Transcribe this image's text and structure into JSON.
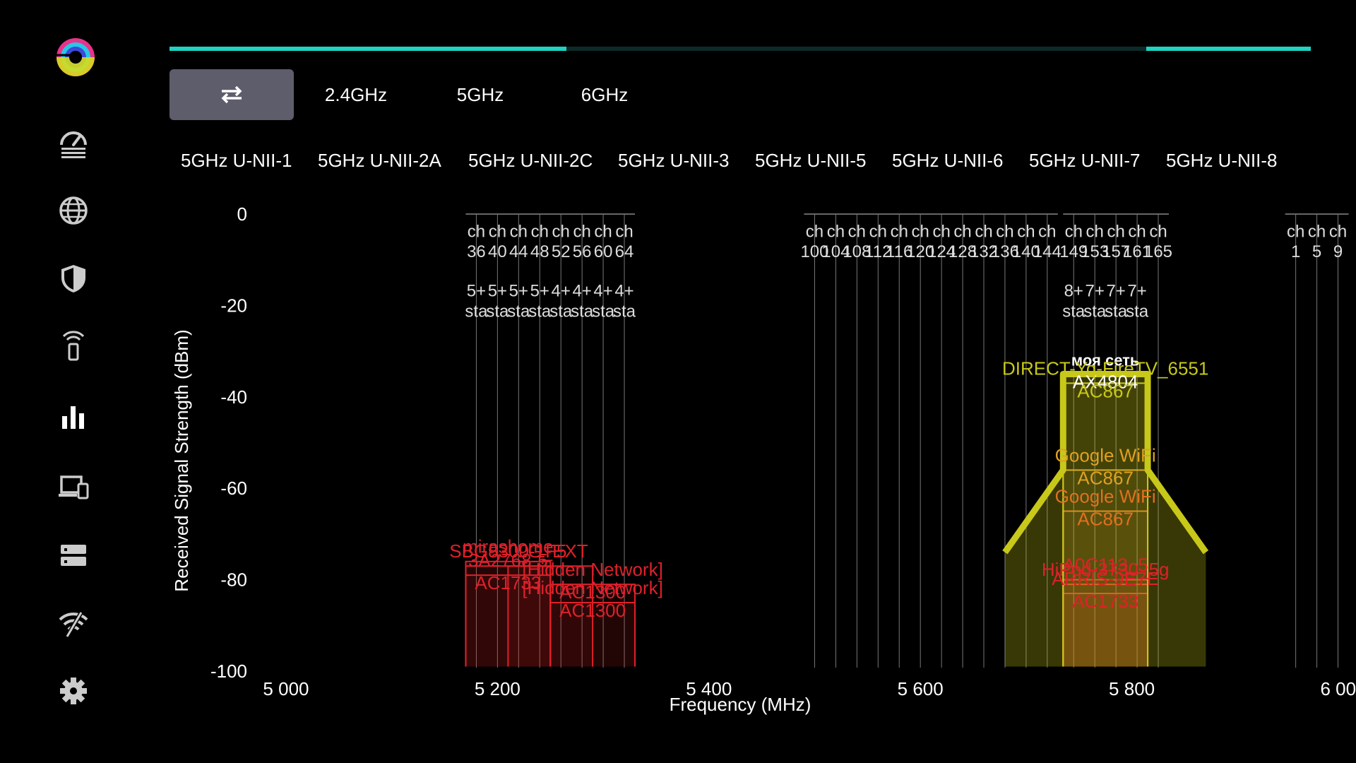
{
  "sidebar": {
    "items": [
      {
        "name": "speedometer-icon",
        "active": false
      },
      {
        "name": "globe-icon",
        "active": false
      },
      {
        "name": "shield-icon",
        "active": false
      },
      {
        "name": "phone-signal-icon",
        "active": false
      },
      {
        "name": "bar-chart-icon",
        "active": true
      },
      {
        "name": "devices-icon",
        "active": false
      },
      {
        "name": "server-icon",
        "active": false
      },
      {
        "name": "wifi-off-icon",
        "active": false
      },
      {
        "name": "gear-icon",
        "active": false
      }
    ]
  },
  "bands": {
    "swap_icon": "swap-arrows-icon",
    "tabs": [
      "2.4GHz",
      "5GHz",
      "6GHz"
    ]
  },
  "subbands": [
    "5GHz U-NII-1",
    "5GHz U-NII-2A",
    "5GHz U-NII-2C",
    "5GHz U-NII-3",
    "5GHz U-NII-5",
    "5GHz U-NII-6",
    "5GHz U-NII-7",
    "5GHz U-NII-8"
  ],
  "colors": {
    "accent": "#1fd3c3",
    "tab_active_bg": "#5e5d6b",
    "strong_network": "#c8c81a",
    "mid_network": "#e0a020",
    "orange_network": "#e07020",
    "weak_network": "#e0202a"
  },
  "chart_data": {
    "type": "area",
    "xlabel": "Frequency (MHz)",
    "ylabel": "Received Signal Strength (dBm)",
    "xlim": [
      4990,
      6000
    ],
    "ylim": [
      -100,
      0
    ],
    "x_ticks": [
      "5 000",
      "5 200",
      "5 400",
      "5 600",
      "5 800",
      "6 000"
    ],
    "x_tick_values": [
      5000,
      5200,
      5400,
      5600,
      5800,
      6000
    ],
    "y_ticks": [
      "0",
      "-20",
      "-40",
      "-60",
      "-80",
      "-100"
    ],
    "y_tick_values": [
      0,
      -20,
      -40,
      -60,
      -80,
      -100
    ],
    "channel_groups": [
      {
        "channels": [
          "36",
          "40",
          "44",
          "48",
          "52",
          "56",
          "60",
          "64"
        ],
        "freqs": [
          5180,
          5200,
          5220,
          5240,
          5260,
          5280,
          5300,
          5320
        ],
        "stations": [
          "5+",
          "5+",
          "5+",
          "5+",
          "4+",
          "4+",
          "4+",
          "4+"
        ]
      },
      {
        "channels": [
          "100",
          "104",
          "108",
          "112",
          "116",
          "120",
          "124",
          "128",
          "132",
          "136",
          "140",
          "144"
        ],
        "freqs": [
          5500,
          5520,
          5540,
          5560,
          5580,
          5600,
          5620,
          5640,
          5660,
          5680,
          5700,
          5720
        ],
        "stations": []
      },
      {
        "channels": [
          "149",
          "153",
          "157",
          "161",
          "165"
        ],
        "freqs": [
          5745,
          5765,
          5785,
          5805,
          5825
        ],
        "stations": [
          "8+",
          "7+",
          "7+",
          "7+"
        ]
      },
      {
        "channels": [
          "1",
          "5",
          "9"
        ],
        "freqs": [
          5955,
          5975,
          5995
        ],
        "stations": []
      }
    ],
    "station_label": "sta",
    "networks": [
      {
        "name": "моя сеть",
        "standard": "AX4804",
        "rssi": -35,
        "center": 5775,
        "width": 80,
        "color": "#c8c81a",
        "text_color": "#ffffff",
        "bold": true
      },
      {
        "name": "DIRECT-Yq-FireTV_6551",
        "standard": "AC867",
        "rssi": -37,
        "center": 5775,
        "width": 80,
        "color": "#c8c81a",
        "text_color": "#c8c81a"
      },
      {
        "name": "Google WiFi",
        "standard": "AC867",
        "rssi": -56,
        "center": 5775,
        "width": 80,
        "color": "#e0a020",
        "text_color": "#e0a020"
      },
      {
        "name": "Google WiFi",
        "standard": "AC867",
        "rssi": -65,
        "center": 5775,
        "width": 80,
        "color": "#e07020",
        "text_color": "#e07020"
      },
      {
        "name": "A0C113_5",
        "standard": "",
        "rssi": -80,
        "center": 5775,
        "width": 80,
        "color": "#e0202a",
        "text_color": "#e0202a"
      },
      {
        "name": "HiPod-3730_5g",
        "standard": "",
        "rssi": -81,
        "center": 5775,
        "width": 80,
        "color": "#e0202a",
        "text_color": "#e0202a"
      },
      {
        "name": "ARRIS-9E7E",
        "standard": "AC1733",
        "rssi": -83,
        "center": 5775,
        "width": 80,
        "color": "#e0202a",
        "text_color": "#e0202a"
      },
      {
        "name": "SBG8300-1F5",
        "standard": "",
        "rssi": -77,
        "center": 5210,
        "width": 80,
        "color": "#e0202a",
        "text_color": "#e0202a"
      },
      {
        "name": "mirashome",
        "standard": "",
        "rssi": -76,
        "center": 5210,
        "width": 80,
        "color": "#e0202a",
        "text_color": "#e0202a"
      },
      {
        "name": "...G_EXT",
        "standard": "",
        "rssi": -77,
        "center": 5250,
        "width": 80,
        "color": "#e0202a",
        "text_color": "#e0202a"
      },
      {
        "name": "3A2768-5",
        "standard": "AC1733",
        "rssi": -79,
        "center": 5210,
        "width": 80,
        "color": "#e0202a",
        "text_color": "#e0202a"
      },
      {
        "name": "[Hidden Network]",
        "standard": "AC1300",
        "rssi": -81,
        "center": 5290,
        "width": 80,
        "color": "#e0202a",
        "text_color": "#e0202a"
      },
      {
        "name": "[Hidden Network]",
        "standard": "AC1300",
        "rssi": -85,
        "center": 5290,
        "width": 80,
        "color": "#e0202a",
        "text_color": "#e0202a"
      }
    ],
    "grid": false
  }
}
